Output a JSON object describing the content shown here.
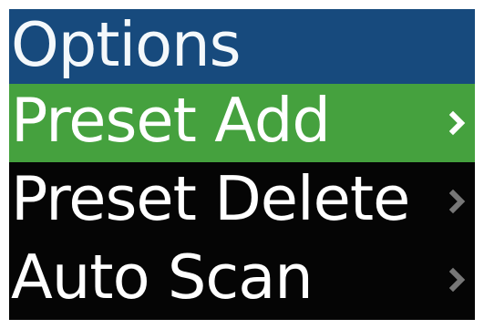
{
  "header": {
    "title": "Options"
  },
  "menu": {
    "items": [
      {
        "label": "Preset Add",
        "selected": true,
        "arrow_icon": "chevron-right-icon"
      },
      {
        "label": "Preset Delete",
        "selected": false,
        "arrow_icon": "chevron-right-icon"
      },
      {
        "label": "Auto Scan",
        "selected": false,
        "arrow_icon": "chevron-right-icon"
      }
    ]
  },
  "colors": {
    "header_background": "#174a7d",
    "selected_background": "#45a13e",
    "screen_background": "#050505",
    "text": "#ffffff",
    "selected_chevron": "#ffffff",
    "chevron": "#777777"
  }
}
